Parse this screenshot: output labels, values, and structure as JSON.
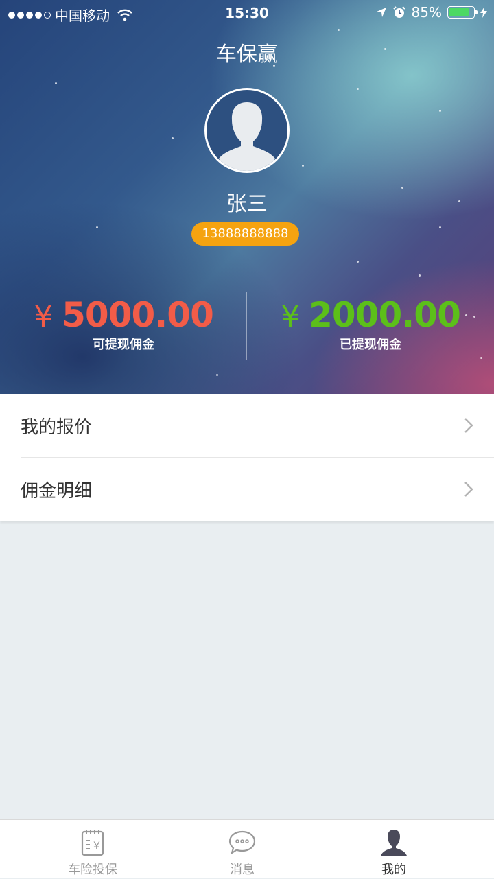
{
  "status_bar": {
    "carrier": "中国移动",
    "time": "15:30",
    "battery_percent": "85%",
    "battery_level": 0.85
  },
  "header": {
    "app_title": "车保赢"
  },
  "profile": {
    "name": "张三",
    "phone": "13888888888"
  },
  "stats": {
    "withdrawable": {
      "currency": "¥",
      "amount": "5000.00",
      "label": "可提现佣金",
      "color": "#f25c48"
    },
    "withdrawn": {
      "currency": "¥",
      "amount": "2000.00",
      "label": "已提现佣金",
      "color": "#5cbf1a"
    }
  },
  "menu": {
    "items": [
      {
        "label": "我的报价",
        "icon": "chevron-right-icon"
      },
      {
        "label": "佣金明细",
        "icon": "chevron-right-icon"
      }
    ]
  },
  "tabbar": {
    "tabs": [
      {
        "label": "车险投保",
        "icon": "insurance-document-icon",
        "active": false
      },
      {
        "label": "消息",
        "icon": "chat-bubble-icon",
        "active": false
      },
      {
        "label": "我的",
        "icon": "user-icon",
        "active": true
      }
    ]
  }
}
